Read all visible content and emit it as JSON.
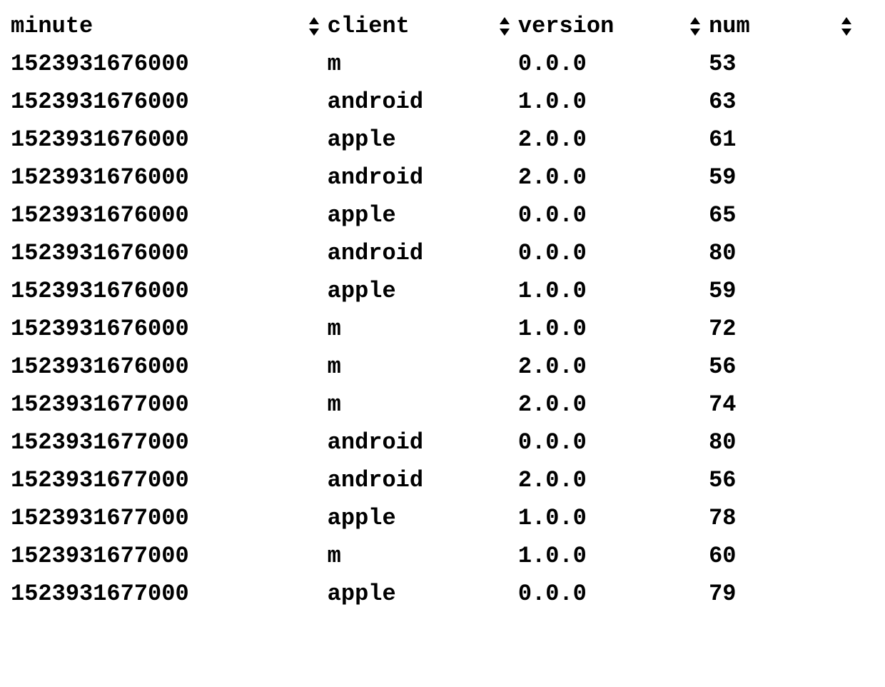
{
  "table": {
    "headers": {
      "minute": "minute",
      "client": "client",
      "version": "version",
      "num": "num"
    },
    "rows": [
      {
        "minute": "1523931676000",
        "client": "m",
        "version": "0.0.0",
        "num": "53"
      },
      {
        "minute": "1523931676000",
        "client": "android",
        "version": "1.0.0",
        "num": "63"
      },
      {
        "minute": "1523931676000",
        "client": "apple",
        "version": "2.0.0",
        "num": "61"
      },
      {
        "minute": "1523931676000",
        "client": "android",
        "version": "2.0.0",
        "num": "59"
      },
      {
        "minute": "1523931676000",
        "client": "apple",
        "version": "0.0.0",
        "num": "65"
      },
      {
        "minute": "1523931676000",
        "client": "android",
        "version": "0.0.0",
        "num": "80"
      },
      {
        "minute": "1523931676000",
        "client": "apple",
        "version": "1.0.0",
        "num": "59"
      },
      {
        "minute": "1523931676000",
        "client": "m",
        "version": "1.0.0",
        "num": "72"
      },
      {
        "minute": "1523931676000",
        "client": "m",
        "version": "2.0.0",
        "num": "56"
      },
      {
        "minute": "1523931677000",
        "client": "m",
        "version": "2.0.0",
        "num": "74"
      },
      {
        "minute": "1523931677000",
        "client": "android",
        "version": "0.0.0",
        "num": "80"
      },
      {
        "minute": "1523931677000",
        "client": "android",
        "version": "2.0.0",
        "num": "56"
      },
      {
        "minute": "1523931677000",
        "client": "apple",
        "version": "1.0.0",
        "num": "78"
      },
      {
        "minute": "1523931677000",
        "client": "m",
        "version": "1.0.0",
        "num": "60"
      },
      {
        "minute": "1523931677000",
        "client": "apple",
        "version": "0.0.0",
        "num": "79"
      }
    ]
  }
}
